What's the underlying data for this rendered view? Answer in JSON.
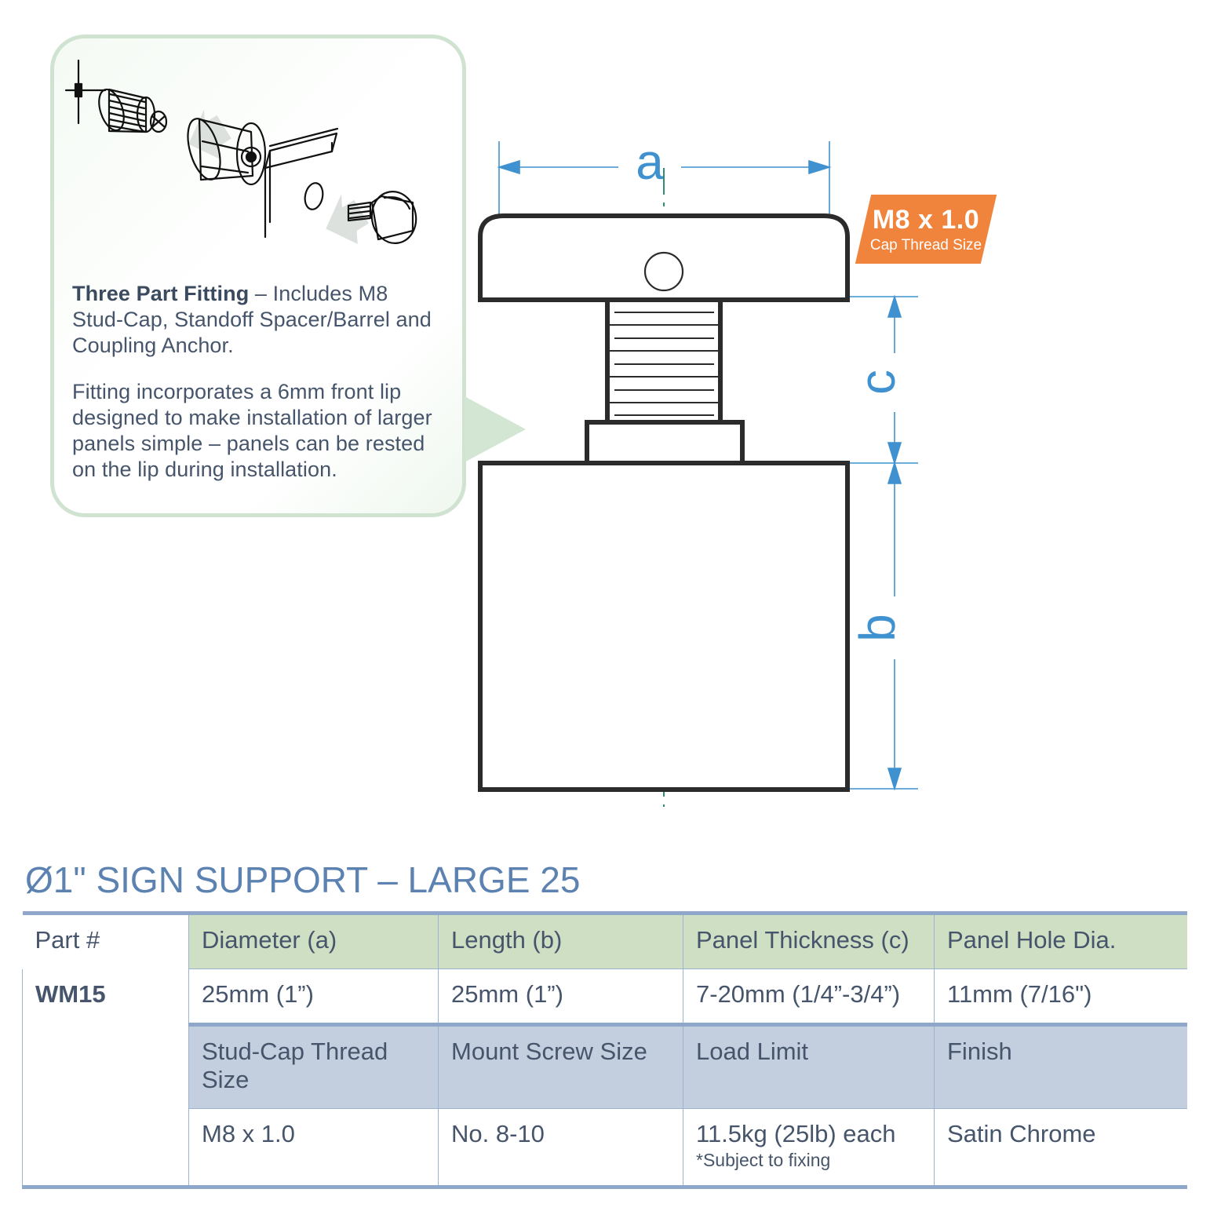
{
  "callout": {
    "lead_label": "Three Part Fitting",
    "lead_rest": " –  Includes M8 Stud-Cap, Standoff Spacer/Barrel and Coupling Anchor.",
    "paragraph2": "Fitting incorporates a 6mm front lip designed to make installation of larger panels simple – panels can be rested on the lip during installation."
  },
  "badge": {
    "thread": "M8 x 1.0",
    "caption": "Cap Thread Size",
    "color": "#f0843c"
  },
  "drawing": {
    "dim_a": "a",
    "dim_b": "b",
    "dim_c": "c",
    "dim_color": "#3f92cf",
    "centerline_color": "#2f8f74",
    "outline_color": "#2b2b2b"
  },
  "title": "Ø1\" SIGN SUPPORT – LARGE 25",
  "table": {
    "part_label": "Part #",
    "part_value": "WM15",
    "headers_green": [
      "Diameter (a)",
      "Length (b)",
      "Panel Thickness (c)",
      "Panel Hole Dia."
    ],
    "values_green": [
      "25mm (1”)",
      "25mm (1”)",
      "7-20mm (1/4”-3/4”)",
      "11mm (7/16\")"
    ],
    "headers_blue": [
      "Stud-Cap Thread Size",
      "Mount Screw Size",
      "Load Limit",
      "Finish"
    ],
    "values_blue": [
      "M8 x 1.0",
      "No. 8-10",
      "11.5kg (25lb) each",
      "Satin Chrome"
    ],
    "load_note": "*Subject to fixing",
    "header_green_color": "#cfdfc4",
    "header_blue_color": "#c3cfdf",
    "rule_color": "#8fa7cb"
  }
}
